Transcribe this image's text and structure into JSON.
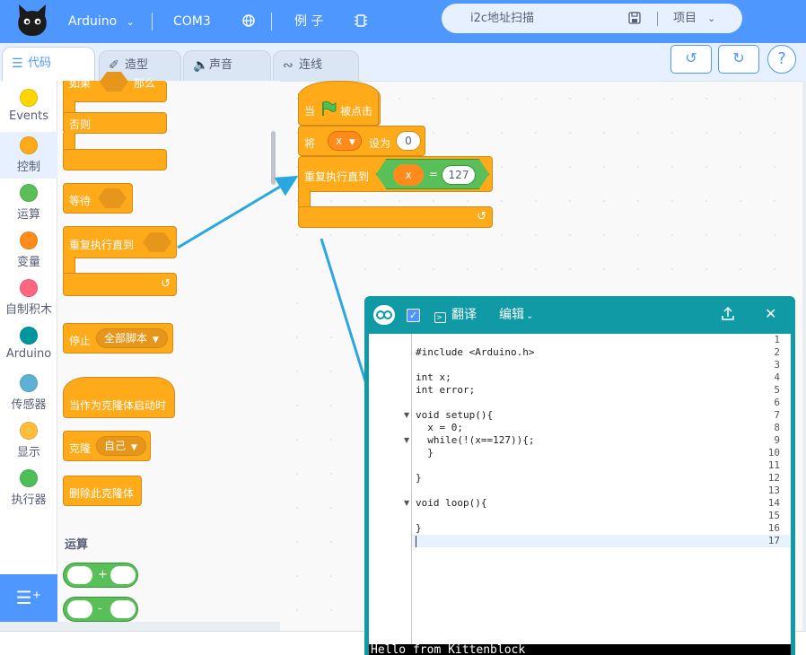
{
  "topbar": {
    "board": "Arduino",
    "port": "COM3",
    "examples": "例 子",
    "project_name": "i2c地址扫描",
    "project_menu": "项目"
  },
  "tabs": [
    {
      "label": "代码",
      "icon": "code-icon",
      "active": true
    },
    {
      "label": "造型",
      "icon": "brush-icon"
    },
    {
      "label": "声音",
      "icon": "speaker-icon"
    },
    {
      "label": "连线",
      "icon": "wire-icon"
    }
  ],
  "categories": [
    {
      "label": "Events",
      "color": "#ffd500"
    },
    {
      "label": "控制",
      "color": "#ffab19"
    },
    {
      "label": "运算",
      "color": "#59c059"
    },
    {
      "label": "变量",
      "color": "#ff8c1a"
    },
    {
      "label": "自制积木",
      "color": "#ff6680"
    },
    {
      "label": "Arduino",
      "color": "#00979c"
    },
    {
      "label": "传感器",
      "color": "#5cb1d6"
    },
    {
      "label": "显示",
      "color": "#ffbf3a"
    },
    {
      "label": "执行器",
      "color": "#4cbf56"
    }
  ],
  "palette": {
    "if_label": "如果",
    "then_label": "那么",
    "else_label": "否则",
    "wait_label": "等待",
    "repeat_until_label": "重复执行直到",
    "stop_label": "停止",
    "stop_option": "全部脚本",
    "clone_start_label": "当作为克隆体启动时",
    "clone_label": "克隆",
    "clone_option": "自己",
    "delete_clone_label": "删除此克隆体",
    "operators_title": "运算",
    "op_plus": "+",
    "op_minus": "-"
  },
  "script": {
    "hat_when": "当",
    "hat_clicked": "被点击",
    "set_label": "将",
    "set_var": "x",
    "set_to": "设为",
    "set_value": "0",
    "repeat_label": "重复执行直到",
    "cond_var": "x",
    "cond_op": "=",
    "cond_value": "127"
  },
  "code_window": {
    "translate": "翻译",
    "edit": "编辑",
    "lines": [
      {
        "n": "1",
        "text": ""
      },
      {
        "n": "2",
        "text": "#include <Arduino.h>"
      },
      {
        "n": "3",
        "text": ""
      },
      {
        "n": "4",
        "text": "int x;"
      },
      {
        "n": "5",
        "text": "int error;"
      },
      {
        "n": "6",
        "text": ""
      },
      {
        "n": "7",
        "text": "void setup(){"
      },
      {
        "n": "8",
        "text": "  x = 0;"
      },
      {
        "n": "9",
        "text": "  while(!(x==127)){;"
      },
      {
        "n": "10",
        "text": "  }"
      },
      {
        "n": "11",
        "text": ""
      },
      {
        "n": "12",
        "text": "}"
      },
      {
        "n": "13",
        "text": ""
      },
      {
        "n": "14",
        "text": "void loop(){"
      },
      {
        "n": "15",
        "text": ""
      },
      {
        "n": "16",
        "text": "}"
      },
      {
        "n": "17",
        "text": ""
      }
    ],
    "console_text": "Hello from Kittenblock"
  }
}
